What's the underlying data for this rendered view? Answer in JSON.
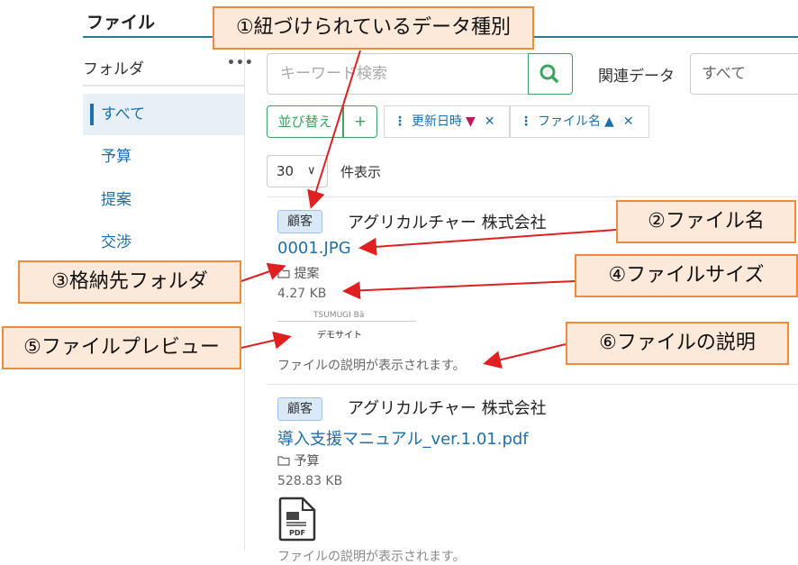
{
  "header": {
    "title": "ファイル"
  },
  "sidebar": {
    "heading": "フォルダ",
    "menu_dots": "•••",
    "items": [
      {
        "label": "すべて"
      },
      {
        "label": "予算"
      },
      {
        "label": "提案"
      },
      {
        "label": "交渉"
      }
    ]
  },
  "search": {
    "placeholder": "キーワード検索",
    "related_label": "関連データ",
    "related_value": "すべて"
  },
  "sort": {
    "button_label": "並び替え",
    "add_label": "+",
    "chips": [
      {
        "label": "更新日時",
        "direction": "▼",
        "remove": "✕"
      },
      {
        "label": "ファイル名",
        "direction": "▲",
        "remove": "✕"
      }
    ]
  },
  "pager": {
    "per_page": "30",
    "chevron": "∨",
    "label": "件表示"
  },
  "files": [
    {
      "tag": "顧客",
      "company": "アグリカルチャー 株式会社",
      "name": "0001.JPG",
      "folder": "提案",
      "size": "4.27 KB",
      "preview_logo": "TSUMUGI Bā",
      "preview_caption": "デモサイト",
      "description": "ファイルの説明が表示されます。"
    },
    {
      "tag": "顧客",
      "company": "アグリカルチャー 株式会社",
      "name": "導入支援マニュアル_ver.1.01.pdf",
      "folder": "予算",
      "size": "528.83 KB",
      "preview_logo": "PDF",
      "description": "ファイルの説明が表示されます。"
    }
  ],
  "callouts": [
    {
      "text": "①紐づけられているデータ種別"
    },
    {
      "text": "②ファイル名"
    },
    {
      "text": "③格納先フォルダ"
    },
    {
      "text": "④ファイルサイズ"
    },
    {
      "text": "⑤ファイルプレビュー"
    },
    {
      "text": "⑥ファイルの説明"
    }
  ],
  "colors": {
    "accent": "#3ba55c",
    "link": "#1f6fa8",
    "callout_fill": "#fde9d9",
    "callout_border": "#ef8a3c",
    "arrow": "#e02020"
  }
}
